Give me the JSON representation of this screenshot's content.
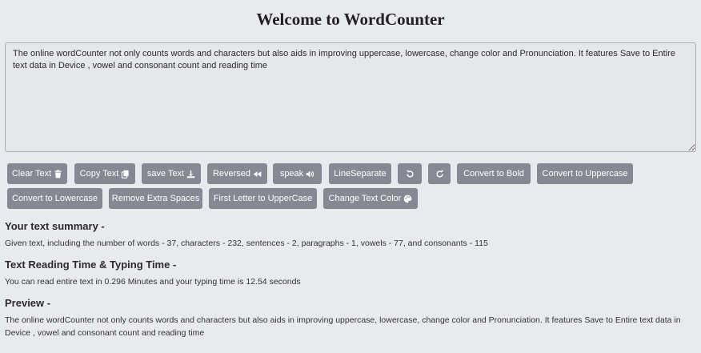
{
  "title": "Welcome to WordCounter",
  "editor": {
    "value": "The online wordCounter not only counts words and characters but also aids in improving uppercase, lowercase, change color and Pronunciation. It features Save to Entire text data in Device , vowel and consonant count and reading time"
  },
  "buttons": {
    "clear": "Clear Text",
    "copy": "Copy Text",
    "save": "save Text",
    "reversed": "Reversed",
    "speak": "speak",
    "line_separate": "LineSeparate",
    "to_bold": "Convert to Bold",
    "to_uppercase": "Convert to Uppercase",
    "to_lowercase": "Convert to Lowercase",
    "remove_spaces": "Remove Extra Spaces",
    "first_letter_upper": "First Letter to UpperCase",
    "change_color": "Change Text Color"
  },
  "icons": {
    "clear": "trash-icon",
    "copy": "copy-icon",
    "save": "download-icon",
    "reversed": "backward-icon",
    "speak": "volume-icon",
    "undo": "undo-icon",
    "redo": "redo-icon",
    "change_color": "palette-icon"
  },
  "summary": {
    "heading": "Your text summary -",
    "text": "Given text, including the number of words - 37, characters - 232, sentences - 2, paragraphs - 1, vowels - 77, and consonants - 115"
  },
  "reading": {
    "heading": "Text Reading Time & Typing Time -",
    "text": "You can read entire text in 0.296 Minutes and your typing time is 12.54 seconds"
  },
  "preview": {
    "heading": "Preview -",
    "text": "The online wordCounter not only counts words and characters but also aids in improving uppercase, lowercase, change color and Pronunciation. It features Save to Entire text data in Device , vowel and consonant count and reading time"
  },
  "colors": {
    "background": "#e9eaee",
    "button": "#868991"
  }
}
